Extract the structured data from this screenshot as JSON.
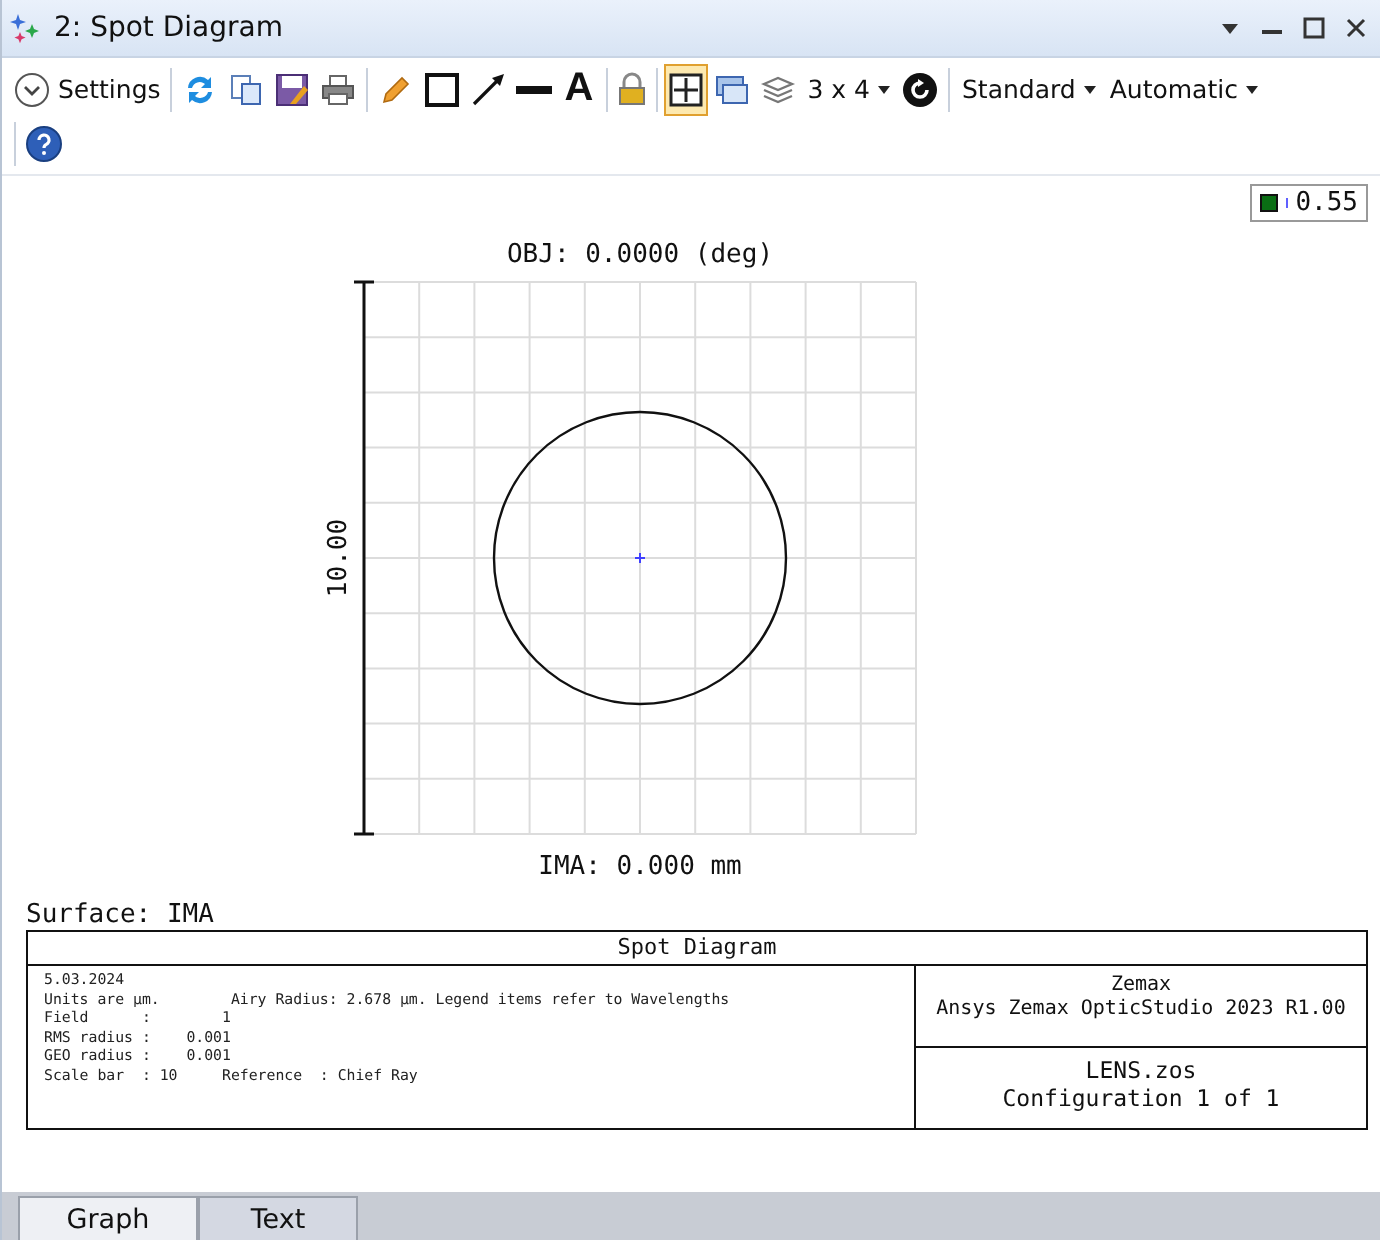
{
  "window": {
    "title": "2: Spot Diagram"
  },
  "toolbar": [
    {
      "kind": "settings",
      "label": "Settings"
    },
    {
      "kind": "separator"
    },
    {
      "kind": "refresh"
    },
    {
      "kind": "copy"
    },
    {
      "kind": "save"
    },
    {
      "kind": "print"
    },
    {
      "kind": "separator"
    },
    {
      "kind": "pencil"
    },
    {
      "kind": "rectangle"
    },
    {
      "kind": "arrow"
    },
    {
      "kind": "line"
    },
    {
      "kind": "letter",
      "label": "A"
    },
    {
      "kind": "separator"
    },
    {
      "kind": "lock"
    },
    {
      "kind": "separator"
    },
    {
      "kind": "grid",
      "on": true
    },
    {
      "kind": "windows",
      "on": false
    },
    {
      "kind": "layers",
      "on": false
    },
    {
      "kind": "dropdown",
      "label": "3 x 4"
    },
    {
      "kind": "reset"
    },
    {
      "kind": "separator"
    },
    {
      "kind": "dropdown",
      "label": "Standard"
    },
    {
      "kind": "dropdown",
      "label": "Automatic"
    },
    {
      "kind": "break"
    },
    {
      "kind": "separator"
    },
    {
      "kind": "help"
    }
  ],
  "legend": [
    {
      "label": "0.55",
      "color": "#0a6e14"
    }
  ],
  "plot": {
    "title": "OBJ: 0.0000 (deg)",
    "xlabel": "IMA: 0.000 mm",
    "scale_label": "10.00"
  },
  "surface": "Surface: IMA",
  "footer": {
    "title": "Spot Diagram",
    "info": [
      "5.03.2024",
      "Units are µm.        Airy Radius: 2.678 µm. Legend items refer to Wavelengths",
      "Field      :        1",
      "RMS radius :    0.001",
      "GEO radius :    0.001",
      "Scale bar  : 10     Reference  : Chief Ray"
    ],
    "company": [
      "Zemax",
      "Ansys Zemax OpticStudio 2023 R1.00"
    ],
    "file": [
      "LENS.zos",
      "Configuration 1 of 1"
    ]
  },
  "tabs": [
    {
      "label": "Graph",
      "selected": true
    },
    {
      "label": "Text",
      "selected": false
    }
  ]
}
